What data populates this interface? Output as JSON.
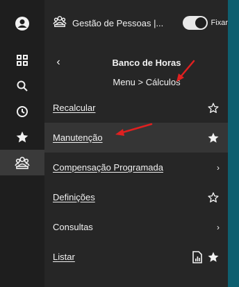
{
  "app": {
    "title": "Gestão de Pessoas |...",
    "pin_label": "Fixar",
    "pin_on": true
  },
  "rail": {
    "items": [
      "user-icon",
      "grid-icon",
      "search-icon",
      "clock-icon",
      "star-icon",
      "people-icon"
    ]
  },
  "header": {
    "back_label": "‹",
    "title": "Banco de Horas",
    "breadcrumb": "Menu  > Cálculos"
  },
  "menu": {
    "items": [
      {
        "label": "Recalcular",
        "icon": "star-outline-icon"
      },
      {
        "label": "Manutenção",
        "icon": "star-filled-icon",
        "selected": true
      },
      {
        "label": "Compensação Programada",
        "icon": "chevron-right-icon"
      },
      {
        "label": "Definições",
        "icon": "star-outline-icon"
      },
      {
        "label": "Consultas",
        "icon": "chevron-right-icon"
      },
      {
        "label": "Listar",
        "icon": "star-filled-icon",
        "extra_icon": "report-icon"
      }
    ]
  },
  "colors": {
    "background": "#262626",
    "rail": "#1e1e1e",
    "accent": "#0e5f6f",
    "annotation": "#e02020"
  }
}
